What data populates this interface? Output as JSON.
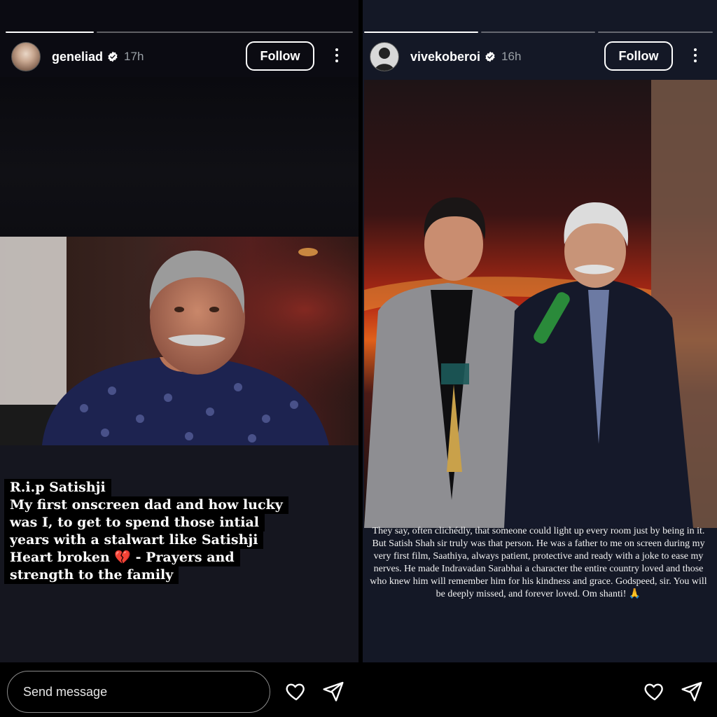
{
  "stories": [
    {
      "username": "geneliad",
      "time": "17h",
      "follow_label": "Follow",
      "progress_segments": 2,
      "progress_active": 0,
      "caption_lines": [
        "R.i.p Satishji",
        "My first onscreen dad  and how lucky",
        "was I, to get to spend those intial",
        "years with a stalwart like Satishji",
        "Heart broken 💔 - Prayers and",
        "strength to the family"
      ]
    },
    {
      "username": "vivekoberoi",
      "time": "16h",
      "follow_label": "Follow",
      "progress_segments": 3,
      "progress_active": 0,
      "caption": "They say, often clichédly, that someone could light up every room just by being in it. But Satish Shah sir truly was that person. He was a father to me on screen during my very first film, Saathiya, always patient, protective and ready with a joke to ease my nerves. He made Indravadan Sarabhai a character the entire country loved and those who knew him will remember him for his kindness and grace. Godspeed, sir. You will be deeply missed, and forever loved. Om shanti! 🙏"
    }
  ],
  "composer": {
    "placeholder": "Send message"
  },
  "icons": [
    "verified-badge-icon",
    "more-options-icon",
    "heart-icon",
    "send-icon"
  ]
}
